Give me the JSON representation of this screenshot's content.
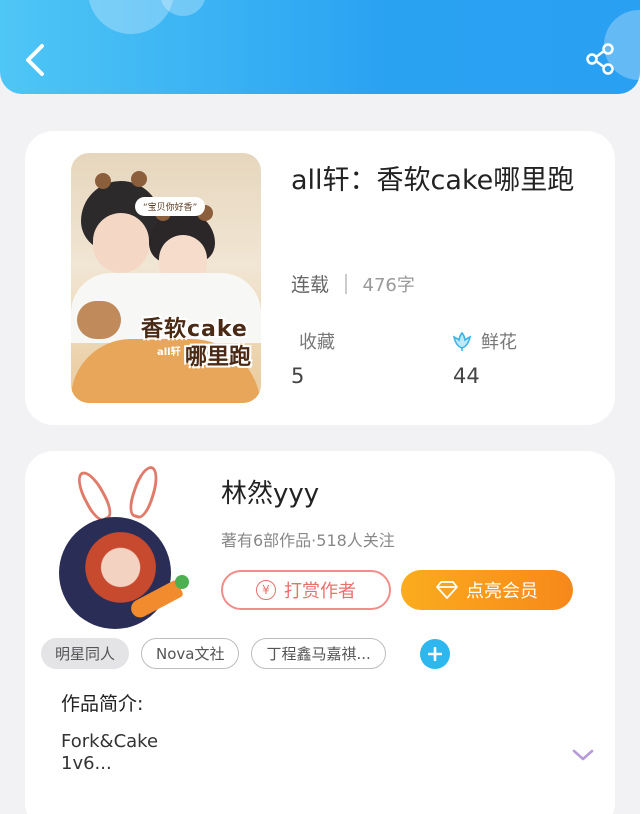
{
  "header": {
    "back_icon": "chevron-left-icon",
    "share_icon": "share-icon"
  },
  "book": {
    "title": "all轩：香软cake哪里跑",
    "status": "连载",
    "word_count": "476字",
    "favorites_label": "收藏",
    "favorites_value": "5",
    "flowers_label": "鲜花",
    "flowers_value": "44",
    "cover": {
      "bubble_text": "“宝贝你好香”",
      "title_line1": "香软cake",
      "title_line2": "哪里跑",
      "subtitle": "all轩"
    }
  },
  "author": {
    "name": "林然yyy",
    "stats": "著有6部作品·518人关注",
    "reward_label": "打赏作者",
    "reward_icon_glyph": "¥",
    "vip_label": "点亮会员"
  },
  "tags": [
    "明星同人",
    "Nova文社",
    "丁程鑫马嘉祺..."
  ],
  "intro": {
    "title": "作品简介:",
    "text_line1": "Fork&Cake",
    "text_line2": "1v6..."
  },
  "colors": {
    "header_blue": "#2aa2f2",
    "accent_orange": "#f7881a",
    "reward_red": "#e8716b",
    "tag_add_blue": "#2db7ee"
  }
}
